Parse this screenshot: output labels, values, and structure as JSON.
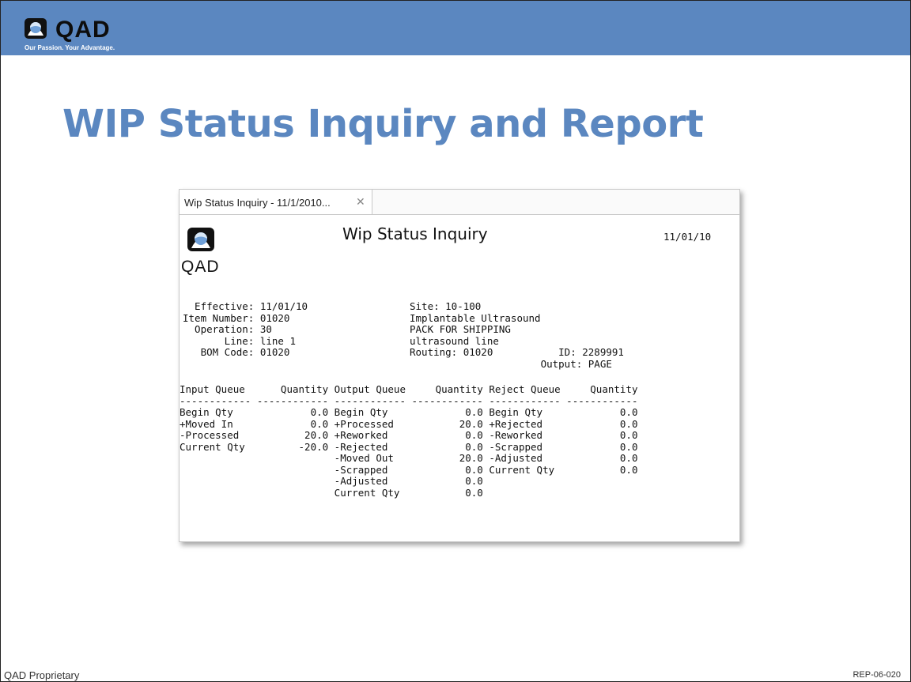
{
  "brand": {
    "logo_text": "QAD",
    "tagline": "Our Passion. Your Advantage."
  },
  "slide": {
    "title": "WIP Status Inquiry and Report",
    "footer_left": "QAD Proprietary",
    "footer_right": "REP-06-020"
  },
  "window": {
    "tab_label": "Wip Status Inquiry - 11/1/2010...",
    "close_glyph": "✕"
  },
  "report": {
    "logo_text": "QAD",
    "title": "Wip Status Inquiry",
    "date": "11/01/10",
    "header_left": "  Effective: 11/01/10\nItem Number: 01020\n  Operation: 30\n       Line: line 1\n   BOM Code: 01020",
    "header_right": "Site: 10-100\nImplantable Ultrasound\nPACK FOR SHIPPING\nultrasound line\nRouting: 01020           ID: 2289991\n                      Output: PAGE",
    "table": "Input Queue      Quantity Output Queue     Quantity Reject Queue     Quantity\n------------ ------------ ------------ ------------ ------------ ------------\nBegin Qty             0.0 Begin Qty             0.0 Begin Qty             0.0\n+Moved In             0.0 +Processed           20.0 +Rejected             0.0\n-Processed           20.0 +Reworked             0.0 -Reworked             0.0\nCurrent Qty         -20.0 -Rejected             0.0 -Scrapped             0.0\n                          -Moved Out           20.0 -Adjusted             0.0\n                          -Scrapped             0.0 Current Qty           0.0\n                          -Adjusted             0.0\n                          Current Qty           0.0"
  },
  "colors": {
    "accent": "#5b87c0",
    "title": "#5b87c0"
  }
}
